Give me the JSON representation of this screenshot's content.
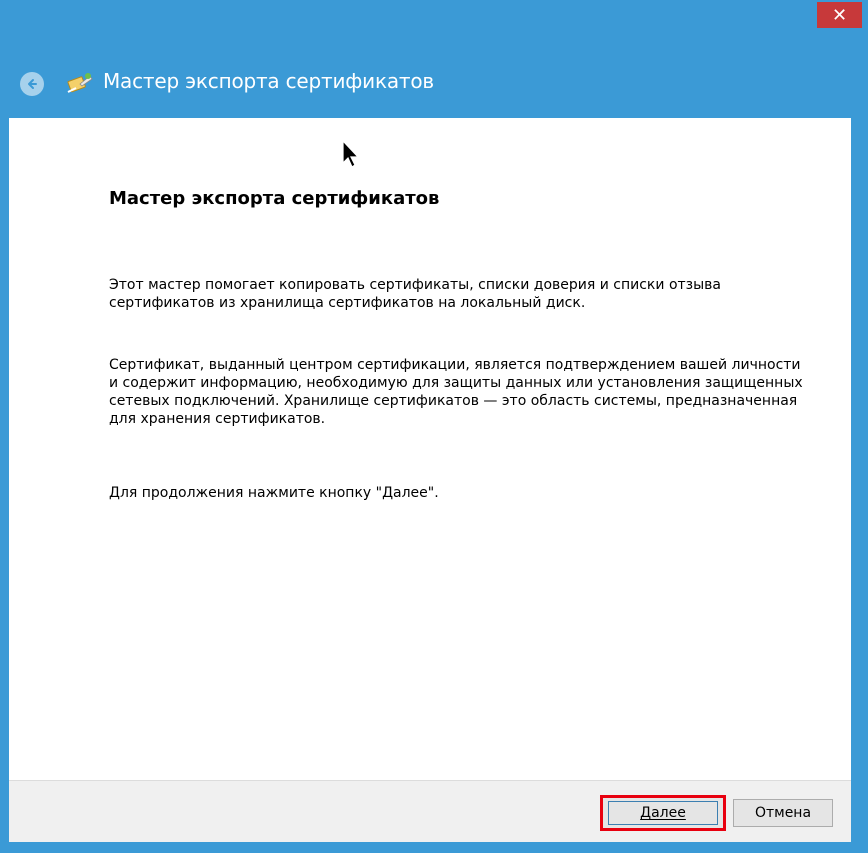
{
  "window": {
    "title": "Мастер экспорта сертификатов",
    "accent_color": "#3b9ad6",
    "close_button_color": "#c7393a",
    "close_glyph": "✕"
  },
  "content": {
    "heading": "Мастер экспорта сертификатов",
    "paragraph1": "Этот мастер помогает копировать сертификаты, списки доверия и списки отзыва сертификатов из хранилища сертификатов на локальный диск.",
    "paragraph2": "Сертификат, выданный центром сертификации, является подтверждением вашей личности и содержит информацию, необходимую для защиты данных или установления защищенных сетевых подключений. Хранилище сертификатов — это область системы, предназначенная для хранения сертификатов.",
    "paragraph3": "Для продолжения нажмите кнопку \"Далее\"."
  },
  "footer": {
    "next_label": "Далее",
    "cancel_label": "Отмена",
    "highlight_color": "#e8000f"
  },
  "icons": {
    "back": "back-arrow-icon",
    "wizard": "certificate-wizard-icon",
    "close": "close-icon",
    "cursor": "mouse-pointer-icon"
  }
}
